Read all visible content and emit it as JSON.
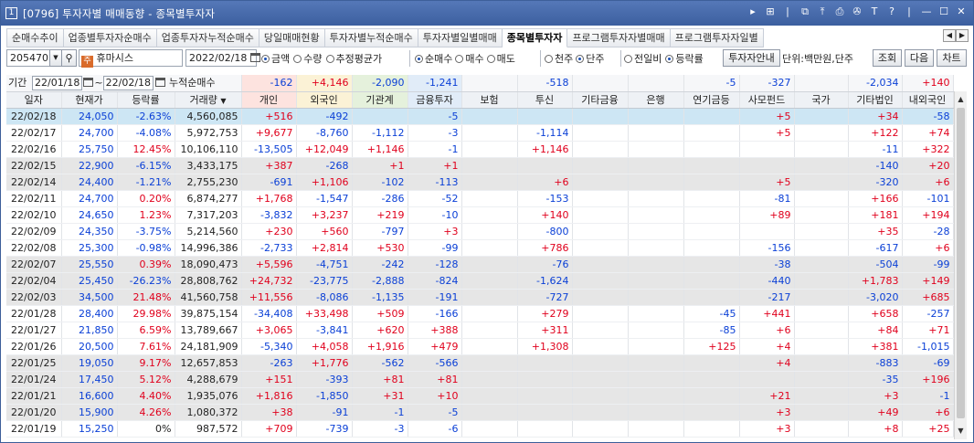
{
  "window": {
    "number": "1",
    "title": "[0796] 투자자별 매매동향 - 종목별투자자"
  },
  "tabs": [
    "순매수추이",
    "업종별투자자순매수",
    "업종투자자누적순매수",
    "당일매매현황",
    "투자자별누적순매수",
    "투자자별일별매매",
    "종목별투자자",
    "프로그램투자자별매매",
    "프로그램투자자일별"
  ],
  "active_tab": 6,
  "controls": {
    "code": "205470",
    "stock_name": "휴마시스",
    "date": "2022/02/18",
    "amount_opts": [
      "금액",
      "수량",
      "추정평균가"
    ],
    "amount_sel": 0,
    "trade_opts": [
      "순매수",
      "매수",
      "매도"
    ],
    "trade_sel": 0,
    "unit_opts": [
      "천주",
      "단주"
    ],
    "unit_sel": 1,
    "ratio_opts": [
      "전일비",
      "등락률"
    ],
    "ratio_sel": 1,
    "guide_btn": "투자자안내",
    "unit_text": "단위:백만원,단주",
    "query_btn": "조회",
    "next_btn": "다음",
    "chart_btn": "차트"
  },
  "period": {
    "label": "기간",
    "from": "22/01/18",
    "to": "22/02/18",
    "cum_label": "누적순매수"
  },
  "summary": [
    "-162",
    "+4,146",
    "-2,090",
    "-1,241",
    "",
    "-518",
    "",
    "",
    "-5",
    "-327",
    "",
    "-2,034",
    "+140"
  ],
  "columns": [
    "일자",
    "현재가",
    "등락률",
    "거래량",
    "개인",
    "외국인",
    "기관계",
    "금융투자",
    "보험",
    "투신",
    "기타금융",
    "은행",
    "연기금등",
    "사모펀드",
    "국가",
    "기타법인",
    "내외국인"
  ],
  "rows": [
    [
      "22/02/18",
      "24,050",
      "-2.63%",
      "4,560,085",
      "+516",
      "-492",
      "",
      "-5",
      "",
      "",
      "",
      "",
      "",
      "+5",
      "",
      "+34",
      "-58"
    ],
    [
      "22/02/17",
      "24,700",
      "-4.08%",
      "5,972,753",
      "+9,677",
      "-8,760",
      "-1,112",
      "-3",
      "",
      "-1,114",
      "",
      "",
      "",
      "+5",
      "",
      "+122",
      "+74"
    ],
    [
      "22/02/16",
      "25,750",
      "12.45%",
      "10,106,110",
      "-13,505",
      "+12,049",
      "+1,146",
      "-1",
      "",
      "+1,146",
      "",
      "",
      "",
      "",
      "",
      "-11",
      "+322"
    ],
    [
      "22/02/15",
      "22,900",
      "-6.15%",
      "3,433,175",
      "+387",
      "-268",
      "+1",
      "+1",
      "",
      "",
      "",
      "",
      "",
      "",
      "",
      "-140",
      "+20"
    ],
    [
      "22/02/14",
      "24,400",
      "-1.21%",
      "2,755,230",
      "-691",
      "+1,106",
      "-102",
      "-113",
      "",
      "+6",
      "",
      "",
      "",
      "+5",
      "",
      "-320",
      "+6"
    ],
    [
      "22/02/11",
      "24,700",
      "0.20%",
      "6,874,277",
      "+1,768",
      "-1,547",
      "-286",
      "-52",
      "",
      "-153",
      "",
      "",
      "",
      "-81",
      "",
      "+166",
      "-101"
    ],
    [
      "22/02/10",
      "24,650",
      "1.23%",
      "7,317,203",
      "-3,832",
      "+3,237",
      "+219",
      "-10",
      "",
      "+140",
      "",
      "",
      "",
      "+89",
      "",
      "+181",
      "+194"
    ],
    [
      "22/02/09",
      "24,350",
      "-3.75%",
      "5,214,560",
      "+230",
      "+560",
      "-797",
      "+3",
      "",
      "-800",
      "",
      "",
      "",
      "",
      "",
      "+35",
      "-28"
    ],
    [
      "22/02/08",
      "25,300",
      "-0.98%",
      "14,996,386",
      "-2,733",
      "+2,814",
      "+530",
      "-99",
      "",
      "+786",
      "",
      "",
      "",
      "-156",
      "",
      "-617",
      "+6"
    ],
    [
      "22/02/07",
      "25,550",
      "0.39%",
      "18,090,473",
      "+5,596",
      "-4,751",
      "-242",
      "-128",
      "",
      "-76",
      "",
      "",
      "",
      "-38",
      "",
      "-504",
      "-99"
    ],
    [
      "22/02/04",
      "25,450",
      "-26.23%",
      "28,808,762",
      "+24,732",
      "-23,775",
      "-2,888",
      "-824",
      "",
      "-1,624",
      "",
      "",
      "",
      "-440",
      "",
      "+1,783",
      "+149"
    ],
    [
      "22/02/03",
      "34,500",
      "21.48%",
      "41,560,758",
      "+11,556",
      "-8,086",
      "-1,135",
      "-191",
      "",
      "-727",
      "",
      "",
      "",
      "-217",
      "",
      "-3,020",
      "+685"
    ],
    [
      "22/01/28",
      "28,400",
      "29.98%",
      "39,875,154",
      "-34,408",
      "+33,498",
      "+509",
      "-166",
      "",
      "+279",
      "",
      "",
      "-45",
      "+441",
      "",
      "+658",
      "-257"
    ],
    [
      "22/01/27",
      "21,850",
      "6.59%",
      "13,789,667",
      "+3,065",
      "-3,841",
      "+620",
      "+388",
      "",
      "+311",
      "",
      "",
      "-85",
      "+6",
      "",
      "+84",
      "+71"
    ],
    [
      "22/01/26",
      "20,500",
      "7.61%",
      "24,181,909",
      "-5,340",
      "+4,058",
      "+1,916",
      "+479",
      "",
      "+1,308",
      "",
      "",
      "+125",
      "+4",
      "",
      "+381",
      "-1,015"
    ],
    [
      "22/01/25",
      "19,050",
      "9.17%",
      "12,657,853",
      "-263",
      "+1,776",
      "-562",
      "-566",
      "",
      "",
      "",
      "",
      "",
      "+4",
      "",
      "-883",
      "-69"
    ],
    [
      "22/01/24",
      "17,450",
      "5.12%",
      "4,288,679",
      "+151",
      "-393",
      "+81",
      "+81",
      "",
      "",
      "",
      "",
      "",
      "",
      "",
      "-35",
      "+196"
    ],
    [
      "22/01/21",
      "16,600",
      "4.40%",
      "1,935,076",
      "+1,816",
      "-1,850",
      "+31",
      "+10",
      "",
      "",
      "",
      "",
      "",
      "+21",
      "",
      "+3",
      "-1"
    ],
    [
      "22/01/20",
      "15,900",
      "4.26%",
      "1,080,372",
      "+38",
      "-91",
      "-1",
      "-5",
      "",
      "",
      "",
      "",
      "",
      "+3",
      "",
      "+49",
      "+6"
    ],
    [
      "22/01/19",
      "15,250",
      "0%",
      "987,572",
      "+709",
      "-739",
      "-3",
      "-6",
      "",
      "",
      "",
      "",
      "",
      "+3",
      "",
      "+8",
      "+25"
    ]
  ],
  "colors": {
    "positive": "#e0001c",
    "negative": "#0a3fd6",
    "selected_row": "#cde6f4",
    "alt_row": "#e6e6e6"
  }
}
